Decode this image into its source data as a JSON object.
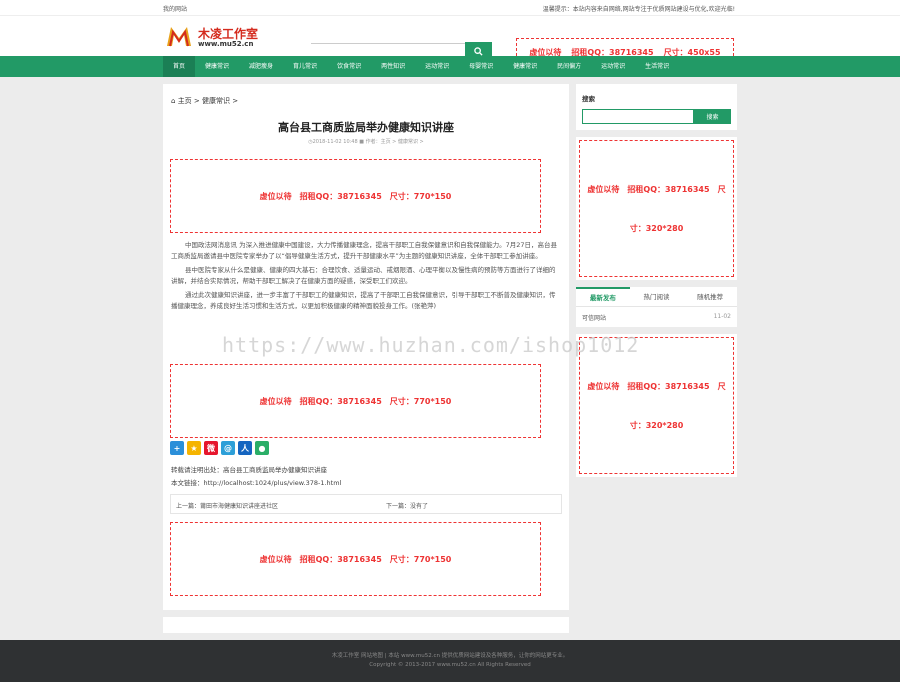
{
  "topbar": {
    "left": "我的网站",
    "right": "温馨提示：本站内容来自网络,网站专注于优质网站建设与优化,欢迎光临!"
  },
  "logo": {
    "name": "木凌工作室",
    "url": "www.mu52.cn"
  },
  "ad_top": {
    "text1": "虚位以待",
    "text2": "招租QQ：38716345",
    "text3": "尺寸：450x55"
  },
  "nav": [
    "首页",
    "健康常识",
    "减肥瘦身",
    "育儿常识",
    "饮食常识",
    "两性知识",
    "运动常识",
    "母婴常识",
    "健康常识",
    "民间偏方",
    "运动常识",
    "生活常识"
  ],
  "breadcrumb": {
    "home": "主页",
    "sep1": ">",
    "cat": "健康常识",
    "sep2": ">"
  },
  "article": {
    "title": "高台县工商质监局举办健康知识讲座",
    "meta": "◷2018-11-02 10:48  ■ 作者：主页 > 健康常识 >",
    "paragraphs": [
      "中国政法网消息讯 为深入推进健康中国建设，大力传播健康理念，提高干部职工自我保健意识和自我保健能力。7月27日，高台县工商质监局邀请县中医院专家举办了以“倡导健康生活方式，提升干部健康水平”为主题的健康知识讲座，全体干部职工参加讲座。",
      "县中医院专家从什么是健康、健康的四大基石：合理饮食、适量运动、戒烟限酒、心理平衡以及慢性病的预防等方面进行了详细的讲解，并结合实际情况，帮助干部职工解决了在健康方面的疑惑，深受职工们欢迎。",
      "通过此次健康知识讲座，进一步丰富了干部职工的健康知识，提高了干部职工自我保健意识，引导干部职工不断普及健康知识，传播健康理念，养成良好生活习惯和生活方式，以更加积极健康的精神面貌投身工作。(张艳萍)"
    ],
    "ad_text1": "虚位以待",
    "ad_text2": "招租QQ：38716345",
    "ad_text3": "尺寸：770*150",
    "source_label": "转载请注明出处：",
    "source_value": "高台县工商质监局举办健康知识讲座",
    "link_label": "本文链接：",
    "link_value": "http://localhost:1024/plus/view.378-1.html",
    "prev_label": "上一篇：",
    "prev_value": "莆田市海健康知识讲座进社区",
    "next_label": "下一篇：",
    "next_value": "没有了"
  },
  "share_icons": [
    {
      "name": "share-more-icon",
      "glyph": "+",
      "color": "#2b8fd9"
    },
    {
      "name": "qzone-icon",
      "glyph": "★",
      "color": "#f5b400"
    },
    {
      "name": "weibo-icon",
      "glyph": "微",
      "color": "#e6162d"
    },
    {
      "name": "tencent-weibo-icon",
      "glyph": "@",
      "color": "#2d9fd8"
    },
    {
      "name": "renren-icon",
      "glyph": "人",
      "color": "#1565c0"
    },
    {
      "name": "wechat-icon",
      "glyph": "●",
      "color": "#2aae67"
    }
  ],
  "sidebar": {
    "search_label": "搜索",
    "search_button": "搜索",
    "ad_text1": "虚位以待",
    "ad_text2": "招租QQ：38716345",
    "ad_text3": "尺",
    "ad_text4": "寸：320*280",
    "tabs": [
      "最新发布",
      "热门阅读",
      "随机推荐"
    ],
    "item_title": "可信网站",
    "item_date": "11-02"
  },
  "watermark": "https://www.huzhan.com/ishop1012",
  "footer": {
    "line1": "木凌工作室 网站地图 | 本站 www.mu52.cn 提供优质网站建设及各种服务，让你的网站更专业。",
    "line2": "Copyright © 2013-2017 www.mu52.cn All Rights Reserved"
  },
  "colors": {
    "accent": "#229a66",
    "ad_red": "#ee3333"
  }
}
